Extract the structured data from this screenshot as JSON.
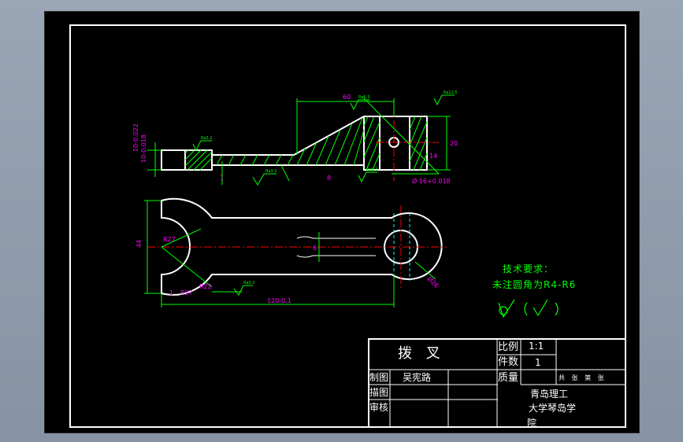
{
  "title_block": {
    "part_name": "拨  叉",
    "scale_label": "比例",
    "scale_value": "1:1",
    "count_label": "件数",
    "count_value": "1",
    "drawn_label": "制图",
    "drawn_by": "吴宪路",
    "mass_label": "质量",
    "sheets_text": "共 张 第 张",
    "traced_label": "描图",
    "checked_label": "审核",
    "school_line1": "青岛理工",
    "school_line2": "大学琴岛学",
    "school_line3": "院"
  },
  "tech_requirements": {
    "heading": "技术要求：",
    "line1": "未注圆角为R4-R6"
  },
  "dimensions": {
    "top_width": "60",
    "top_height": "20",
    "top_hole": "Ø 16+0.018",
    "top_inner": "14",
    "left_tol": "10-0.022",
    "left_tol2": "10-0.018",
    "gap": "8",
    "thick": "1",
    "plan_height": "44",
    "plan_radius": "R27",
    "plan_chamfer": "R27",
    "plan_length": "120-0.1",
    "plan_slot": "6",
    "plan_bore": "Ø26",
    "plan_left": "R22",
    "plan_small": "1"
  },
  "roughness": {
    "r1": "Ra3.2",
    "r2": "Ra6.3",
    "r3": "Ra12.5",
    "r4": "Ra3.2",
    "r5": "Ra6.3",
    "r6": "Ra3.2"
  },
  "colors": {
    "outline": "#ffffff",
    "dimension": "#00ff00",
    "text_dim": "#ff00ff",
    "centerline": "#ff0000",
    "hidden": "#00ffff",
    "hatch": "#00ff00"
  }
}
